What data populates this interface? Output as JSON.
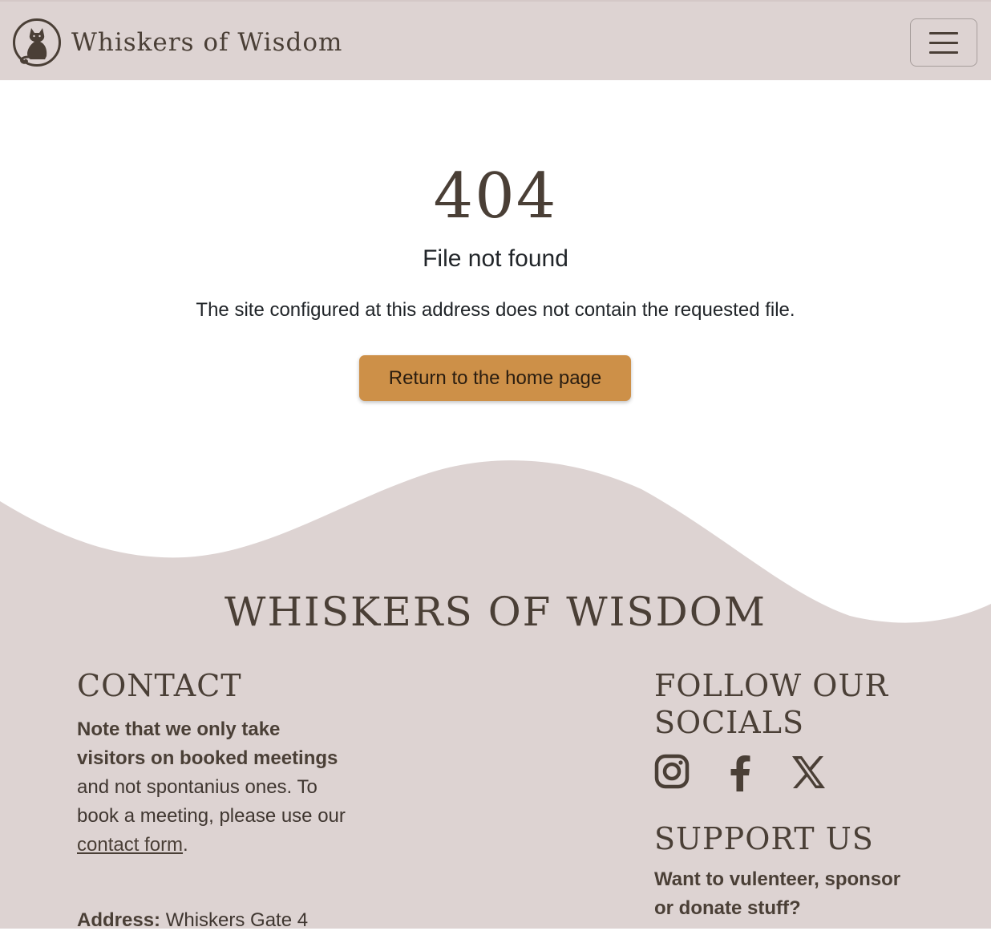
{
  "header": {
    "brand_name": "Whiskers of Wisdom",
    "logo_icon": "cat-logo-icon",
    "menu_icon": "hamburger-menu-icon"
  },
  "error": {
    "code": "404",
    "title": "File not found",
    "message": "The site configured at this address does not contain the requested file.",
    "button_label": "Return to the home page"
  },
  "footer": {
    "brand_name": "WHISKERS OF WISDOM",
    "contact": {
      "heading": "CONTACT",
      "note_bold": "Note that we only take visitors on booked meetings",
      "note_rest": " and not spontanius ones. To book a meeting, please use our ",
      "link_text": "contact form",
      "link_after": ".",
      "address_label": "Address:",
      "address_value": " Whiskers Gate 4"
    },
    "socials": {
      "heading": "FOLLOW OUR SOCIALS",
      "icons": [
        "instagram-icon",
        "facebook-icon",
        "x-twitter-icon"
      ]
    },
    "support": {
      "heading": "SUPPORT US",
      "text": "Want to vulenteer, sponsor or donate stuff?"
    }
  },
  "colors": {
    "header_bg": "#ddd3d2",
    "footer_bg": "#ddd3d2",
    "brand_text": "#4a3f36",
    "button_bg": "#cd9048"
  }
}
